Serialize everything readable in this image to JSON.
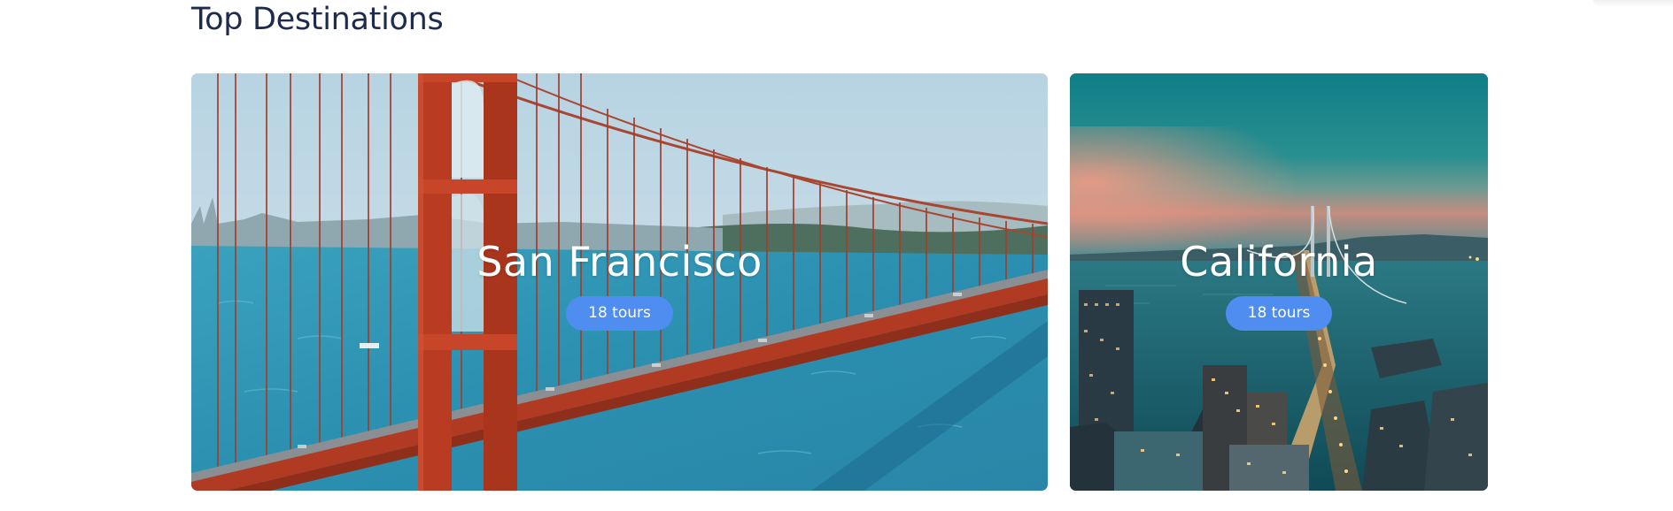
{
  "section": {
    "title": "Top Destinations"
  },
  "destinations": [
    {
      "name": "San Francisco",
      "tours": "18 tours",
      "image": "golden-gate-bridge-photo"
    },
    {
      "name": "California",
      "tours": "18 tours",
      "image": "bay-bridge-dusk-photo"
    }
  ],
  "colors": {
    "title": "#1f2b4d",
    "badge": "#4f8df0",
    "card_text": "#ffffff"
  }
}
